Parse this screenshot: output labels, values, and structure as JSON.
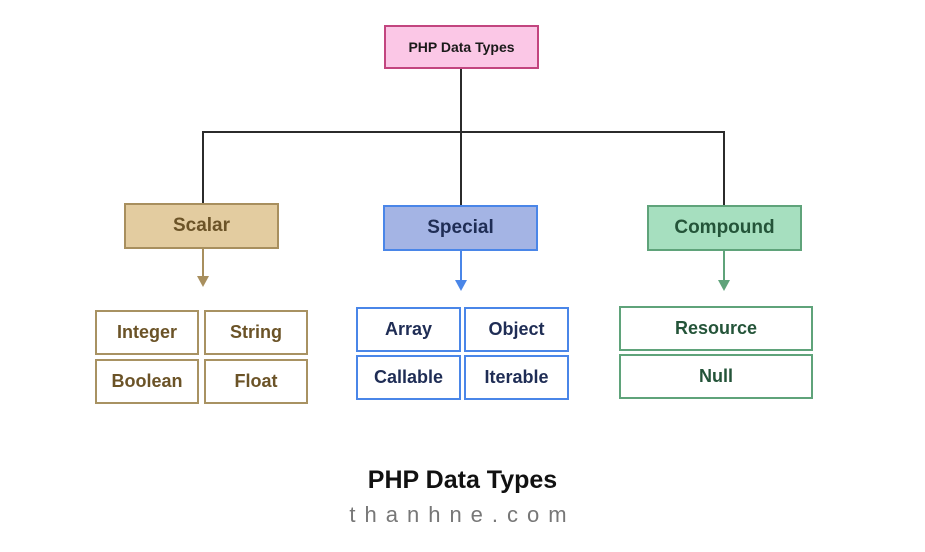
{
  "root": {
    "label": "PHP Data Types"
  },
  "categories": [
    {
      "label": "Scalar",
      "color": "#e3cca0",
      "children": [
        "Integer",
        "String",
        "Boolean",
        "Float"
      ]
    },
    {
      "label": "Special",
      "color": "#a4b4e4",
      "children": [
        "Array",
        "Object",
        "Callable",
        "Iterable"
      ]
    },
    {
      "label": "Compound",
      "color": "#a6dfbf",
      "children": [
        "Resource",
        "Null"
      ]
    }
  ],
  "caption": {
    "title": "PHP Data Types",
    "site": "thanhne.com"
  }
}
